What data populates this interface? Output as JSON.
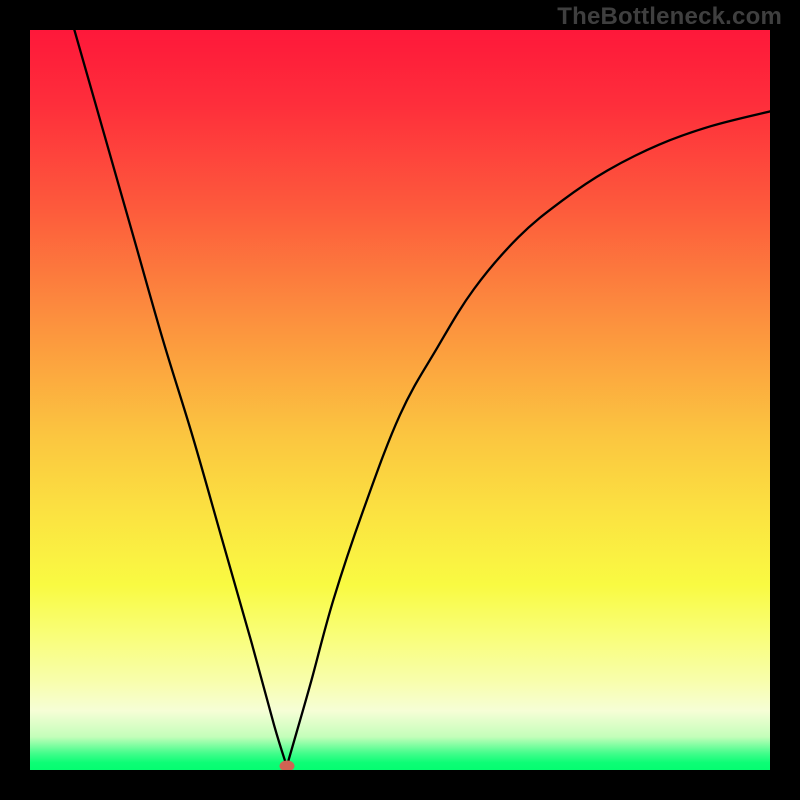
{
  "watermark": "TheBottleneck.com",
  "chart_data": {
    "type": "line",
    "title": "",
    "xlabel": "",
    "ylabel": "",
    "xlim": [
      0,
      100
    ],
    "ylim": [
      0,
      100
    ],
    "legend": false,
    "grid": false,
    "background_gradient": {
      "top": "#fe183a",
      "mid": "#fbe441",
      "bottom": "#05fd71"
    },
    "marker": {
      "x_pct": 34.7,
      "y_pct": 0.5,
      "color": "#d16353"
    },
    "series": [
      {
        "name": "curve",
        "stroke": "#000000",
        "x": [
          6,
          10,
          14,
          18,
          22,
          26,
          30,
          33,
          34.7,
          36,
          38,
          41,
          45,
          50,
          55,
          60,
          66,
          72,
          78,
          85,
          92,
          100
        ],
        "y_pct": [
          100,
          86,
          72,
          58,
          45,
          31,
          17,
          6,
          0.5,
          5,
          12,
          23,
          35,
          48,
          57,
          65,
          72,
          77,
          81,
          84.5,
          87,
          89
        ]
      }
    ]
  }
}
